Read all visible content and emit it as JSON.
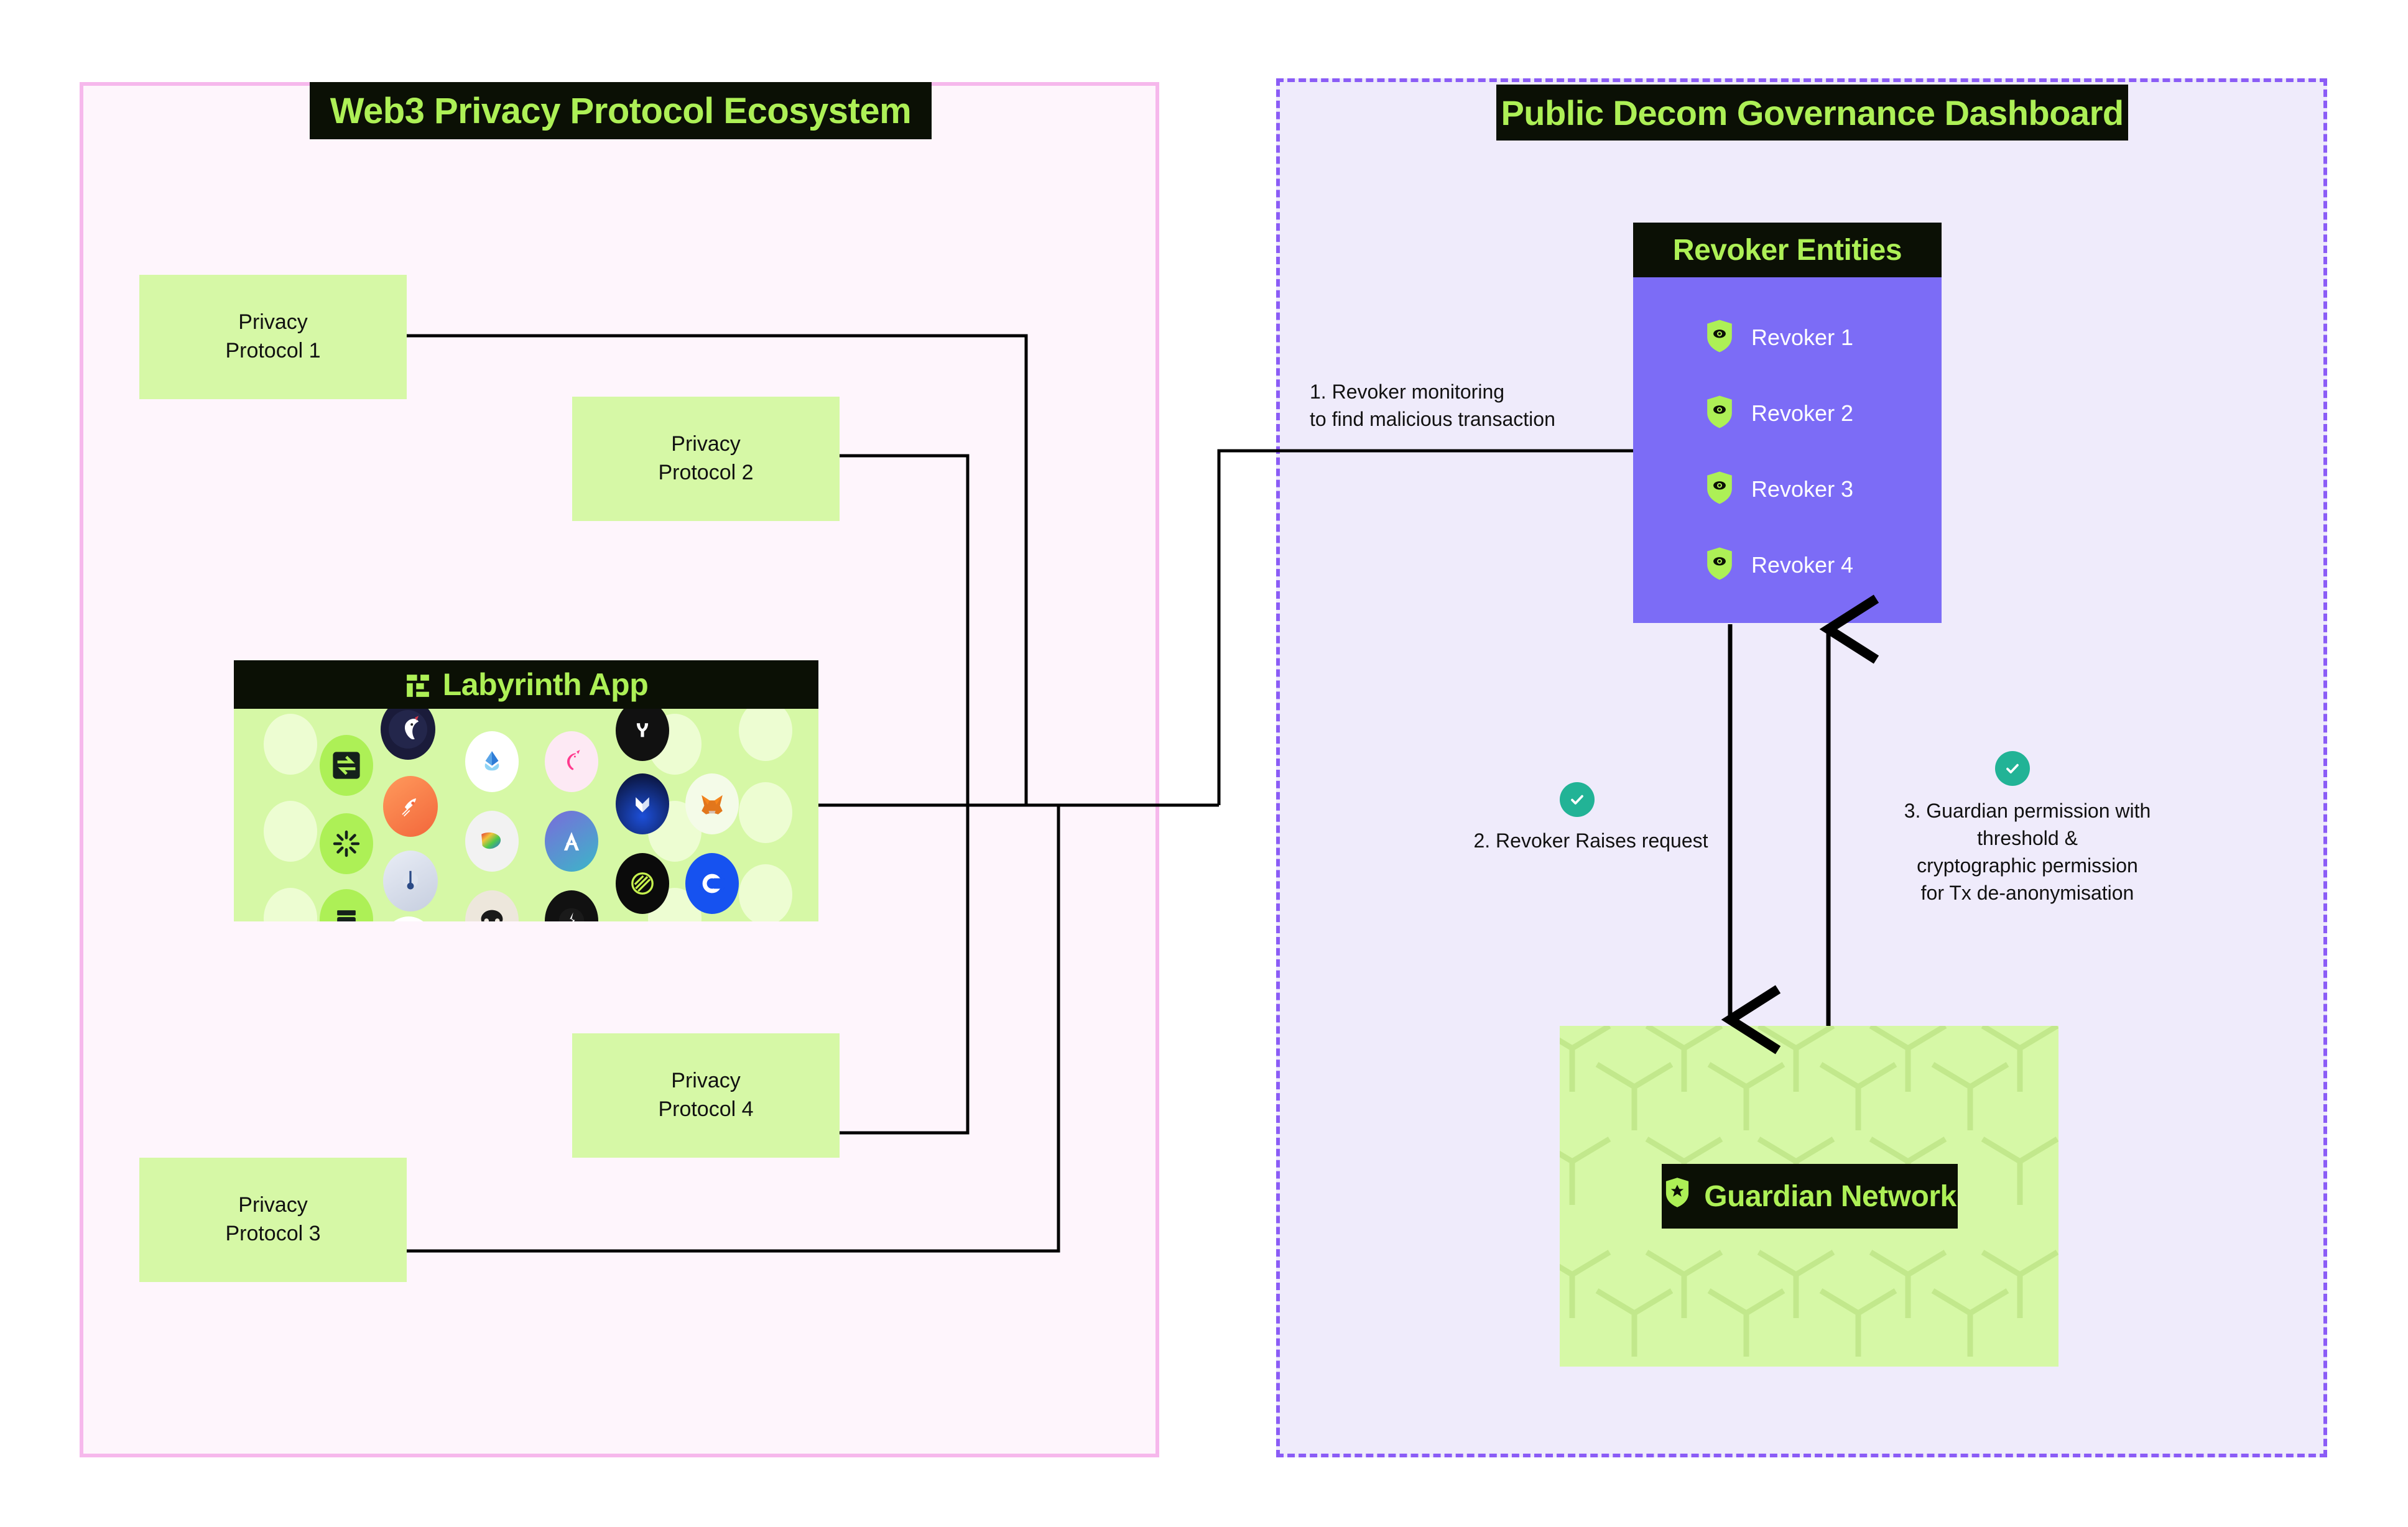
{
  "left_panel": {
    "title": "Web3 Privacy Protocol Ecosystem",
    "border_color": "#F6B8EC",
    "fill_color": "#FEF5FC",
    "protocols": [
      {
        "id": "proto1",
        "label": "Privacy\nProtocol 1",
        "line1": "Privacy",
        "line2": "Protocol 1"
      },
      {
        "id": "proto2",
        "label": "Privacy\nProtocol 2",
        "line1": "Privacy",
        "line2": "Protocol 2"
      },
      {
        "id": "proto3",
        "label": "Privacy\nProtocol 3",
        "line1": "Privacy",
        "line2": "Protocol 3"
      },
      {
        "id": "proto4",
        "label": "Privacy\nProtocol 4",
        "line1": "Privacy",
        "line2": "Protocol 4"
      }
    ],
    "labyrinth": {
      "title": "Labyrinth App",
      "icon": "labyrinth-logo-icon",
      "app_icons": [
        "swap-arrows-icon",
        "onein ch-unicorn-icon",
        "lido-droplet-icon",
        "uniswap-unicorn-icon",
        "yield-protocol-icon",
        "metamask-fox-icon",
        "rocket-pool-icon",
        "infinex-icon",
        "sun-burst-icon",
        "balancer-icon",
        "aave-icon",
        "coinbase-icon",
        "compass-dial-icon",
        "ethena-icon",
        "wallet-icon",
        "yearn-owl-icon",
        "lombard-icon",
        "morpho-icon",
        "spiral-icon",
        "cow-swap-icon"
      ]
    }
  },
  "right_panel": {
    "title": "Public Decom Governance Dashboard",
    "border_color": "#8B5CF6",
    "fill_color": "#EFEBFB",
    "revoker_entities": {
      "title": "Revoker Entities",
      "panel_color": "#7C6CF6",
      "items": [
        {
          "label": "Revoker 1",
          "icon": "shield-eye-icon"
        },
        {
          "label": "Revoker 2",
          "icon": "shield-eye-icon"
        },
        {
          "label": "Revoker 3",
          "icon": "shield-eye-icon"
        },
        {
          "label": "Revoker 4",
          "icon": "shield-eye-icon"
        }
      ]
    },
    "guardian_network": {
      "title": "Guardian Network",
      "icon": "shield-star-icon",
      "fill_color": "#D6F8A6"
    },
    "steps": [
      {
        "number": "1.",
        "line1": "1.  Revoker monitoring",
        "line2": "to find malicious transaction",
        "icon": null
      },
      {
        "number": "2.",
        "line1": "2.  Revoker Raises request",
        "icon": "check-circle-icon",
        "icon_color": "#22B396"
      },
      {
        "number": "3.",
        "line1": "3.  Guardian permission with",
        "line2": "threshold &",
        "line3": "cryptographic permission",
        "line4": "for Tx de-anonymisation",
        "icon": "check-circle-icon",
        "icon_color": "#22B396"
      }
    ]
  },
  "theme": {
    "accent_green": "#ADF056",
    "box_green": "#D6F8A6",
    "black": "#0B1005",
    "purple": "#7C6CF6",
    "teal": "#22B396"
  }
}
